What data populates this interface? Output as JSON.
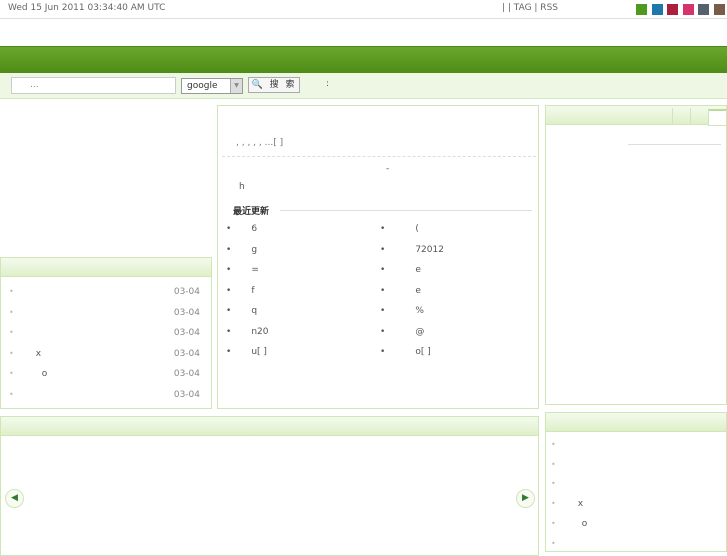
{
  "topbar": {
    "date": "Wed 15 Jun 2011 03:34:40 AM UTC",
    "links": "|      | TAG   | RSS",
    "swatches": [
      "#4f9a1e",
      "#2277aa",
      "#aa1f3c",
      "#d6336c",
      "#56616b",
      "#7a5a48"
    ]
  },
  "search": {
    "placeholder": "...",
    "engine": "google",
    "button": "🔍 搜 索",
    "colon": ":"
  },
  "left_list": {
    "items": [
      {
        "t": "",
        "d": "03-04"
      },
      {
        "t": "",
        "d": "03-04"
      },
      {
        "t": "",
        "d": "03-04"
      },
      {
        "t": "x",
        "d": "03-04"
      },
      {
        "t": "o",
        "d": "03-04"
      },
      {
        "t": "",
        "d": "03-04"
      }
    ]
  },
  "center": {
    "intro": ",          ,        ,         ,           ,        ...[  ]",
    "dash": "-",
    "h": "h",
    "recent_title": "最近更新",
    "col1": [
      "6",
      "g",
      "=",
      "f",
      "q",
      "n20",
      "u[ ]"
    ],
    "col2": [
      "(",
      "72012",
      "e",
      "e",
      "%",
      "@",
      "o[ ]"
    ]
  },
  "right_list": {
    "items": [
      "",
      "",
      "",
      "x",
      "o",
      ""
    ]
  },
  "carousel": {
    "prev": "◀",
    "next": "▶"
  }
}
